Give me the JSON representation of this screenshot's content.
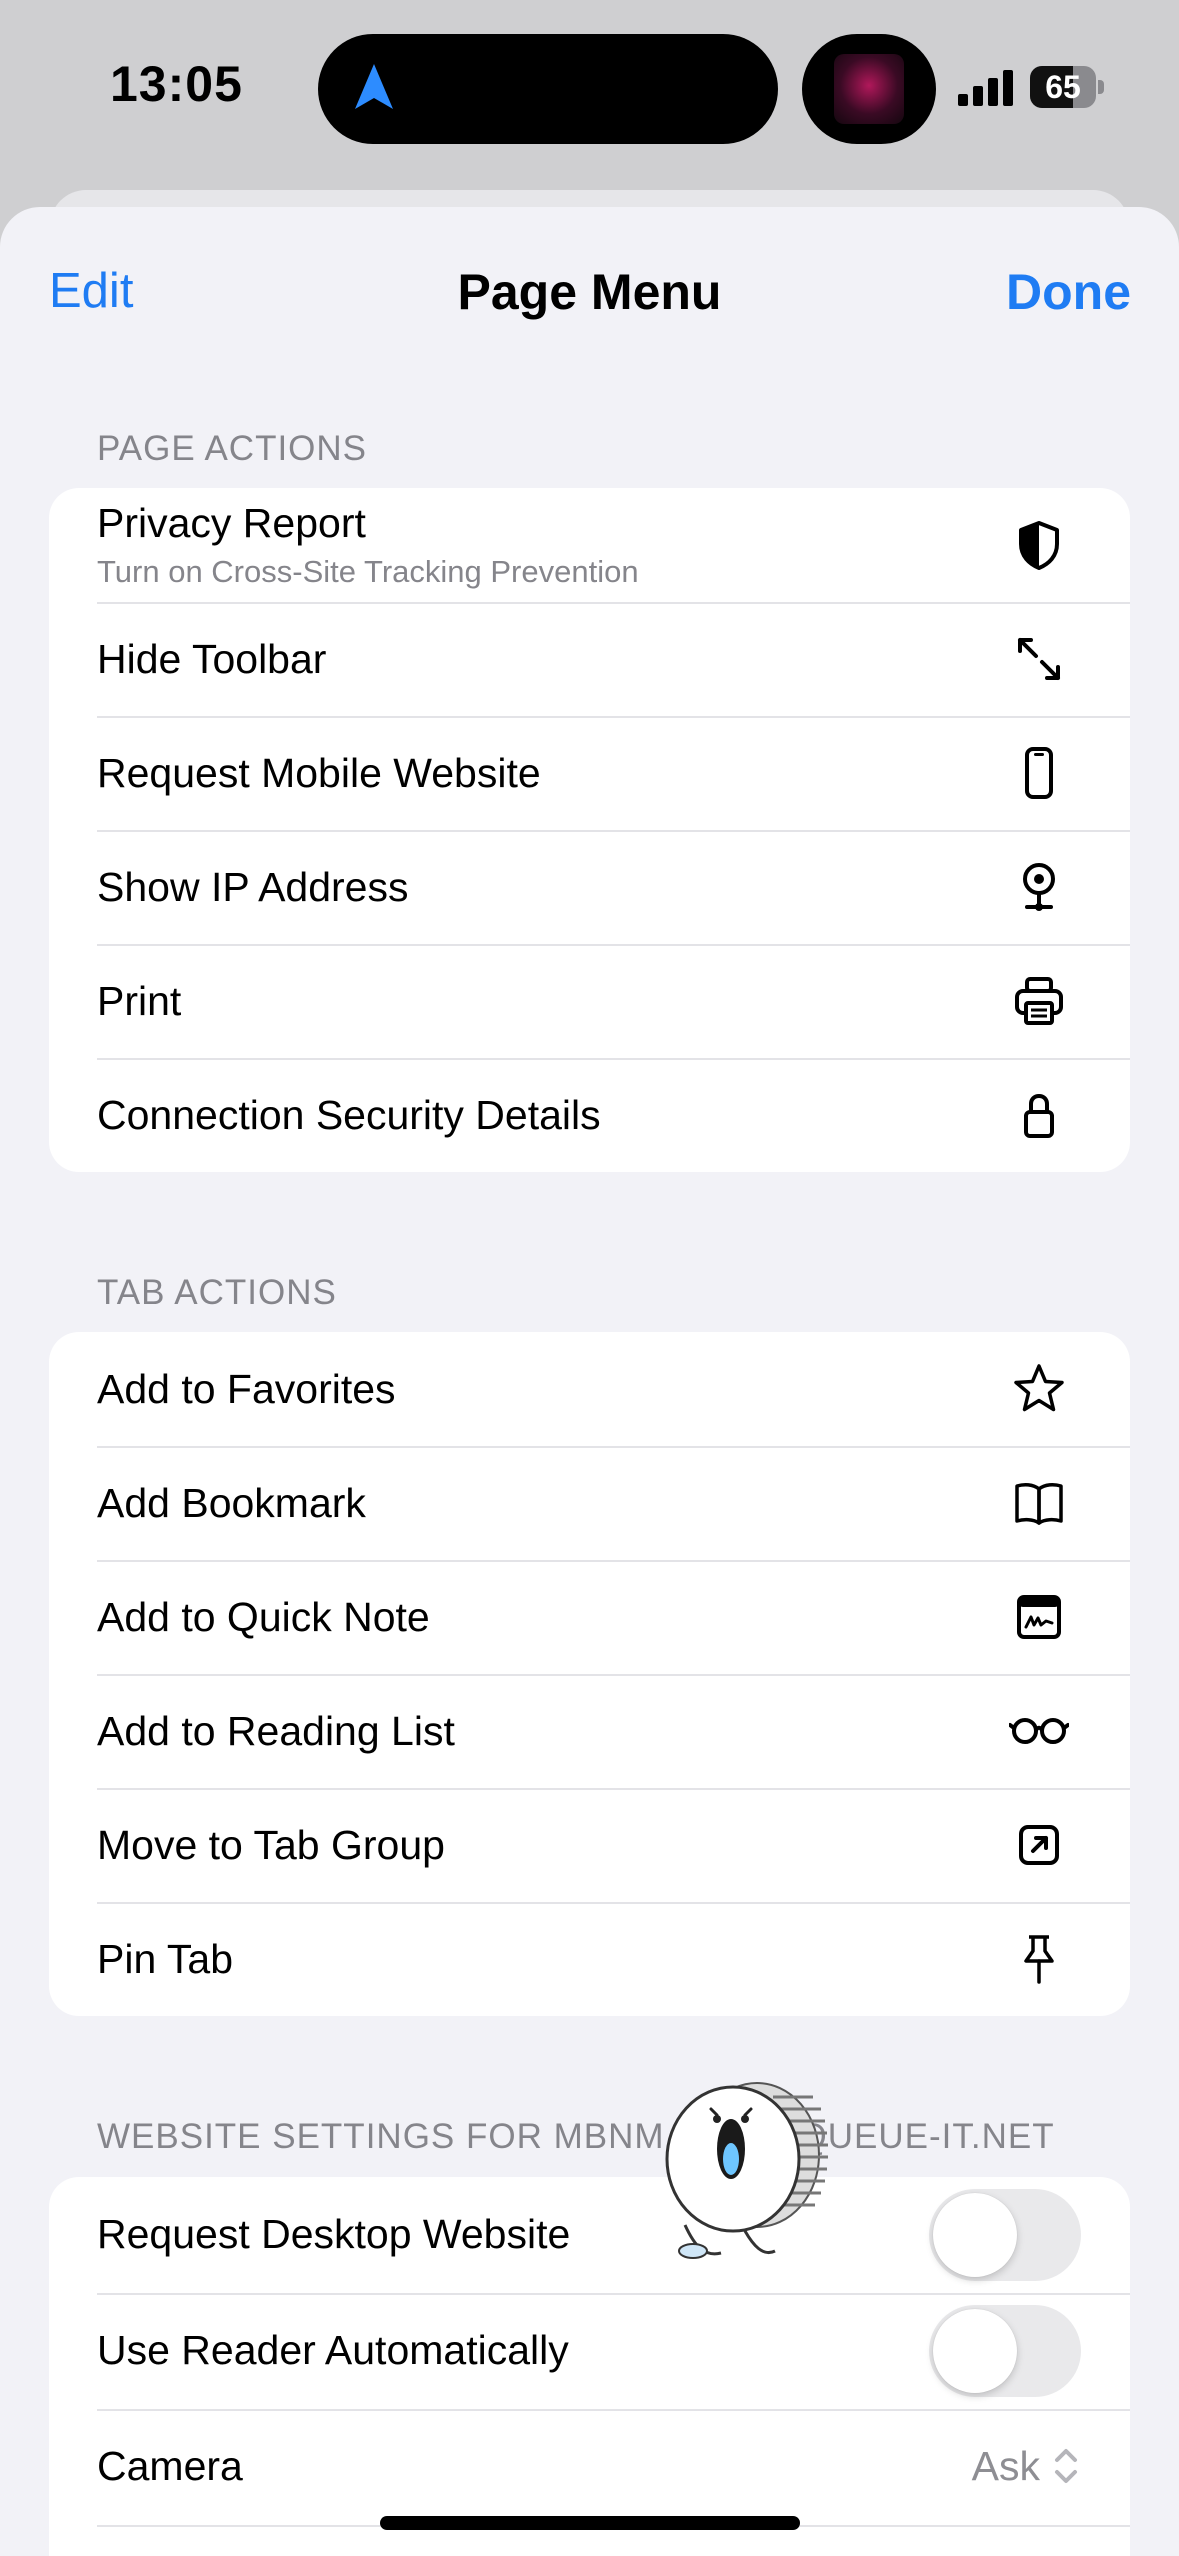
{
  "status_bar": {
    "time": "13:05",
    "battery": "65",
    "battery_level": 0.65
  },
  "sheet": {
    "edit_label": "Edit",
    "title": "Page Menu",
    "done_label": "Done"
  },
  "page_actions": {
    "header": "PAGE ACTIONS",
    "items": [
      {
        "label": "Privacy Report",
        "sublabel": "Turn on Cross-Site Tracking Prevention",
        "icon": "shield-half-icon"
      },
      {
        "label": "Hide Toolbar",
        "icon": "expand-arrows-icon"
      },
      {
        "label": "Request Mobile Website",
        "icon": "iphone-icon"
      },
      {
        "label": "Show IP Address",
        "icon": "location-pin-icon"
      },
      {
        "label": "Print",
        "icon": "printer-icon"
      },
      {
        "label": "Connection Security Details",
        "icon": "lock-icon"
      }
    ]
  },
  "tab_actions": {
    "header": "TAB ACTIONS",
    "items": [
      {
        "label": "Add to Favorites",
        "icon": "star-icon"
      },
      {
        "label": "Add Bookmark",
        "icon": "book-icon"
      },
      {
        "label": "Add to Quick Note",
        "icon": "quick-note-icon"
      },
      {
        "label": "Add to Reading List",
        "icon": "glasses-icon"
      },
      {
        "label": "Move to Tab Group",
        "icon": "arrow-up-right-square-icon"
      },
      {
        "label": "Pin Tab",
        "icon": "pin-icon"
      }
    ]
  },
  "website_settings": {
    "header": "WEBSITE SETTINGS FOR MBNM",
    "header_tail": "QUEUE-IT.NET",
    "request_desktop": {
      "label": "Request Desktop Website",
      "on": false
    },
    "reader_auto": {
      "label": "Use Reader Automatically",
      "on": false
    },
    "camera": {
      "label": "Camera",
      "value": "Ask"
    }
  },
  "colors": {
    "accent": "#1f7cf3",
    "background": "#f2f2f7",
    "secondary_text": "#85858b"
  }
}
